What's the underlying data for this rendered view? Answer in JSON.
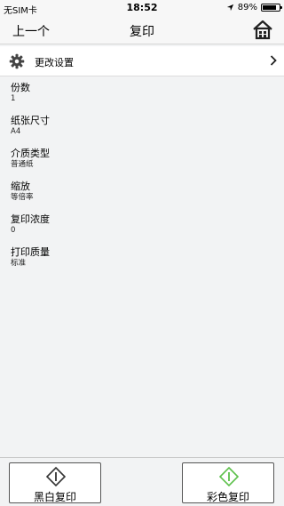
{
  "status_bar": {
    "carrier": "无SIM卡",
    "time": "18:52",
    "battery_text": "89%",
    "battery_level": 0.89
  },
  "nav": {
    "back_label": "上一个",
    "title": "复印",
    "home_icon": "home-icon"
  },
  "settings_row": {
    "label": "更改设置",
    "icon": "gear-icon"
  },
  "items": [
    {
      "name": "份数",
      "value": "1"
    },
    {
      "name": "纸张尺寸",
      "value": "A4"
    },
    {
      "name": "介质类型",
      "value": "普通纸"
    },
    {
      "name": "缩放",
      "value": "等倍率"
    },
    {
      "name": "复印浓度",
      "value": "0"
    },
    {
      "name": "打印质量",
      "value": "标准"
    }
  ],
  "buttons": {
    "mono_label": "黑白复印",
    "color_label": "彩色复印",
    "mono_icon_color": "#333333",
    "color_icon_color": "#5cc04a"
  }
}
